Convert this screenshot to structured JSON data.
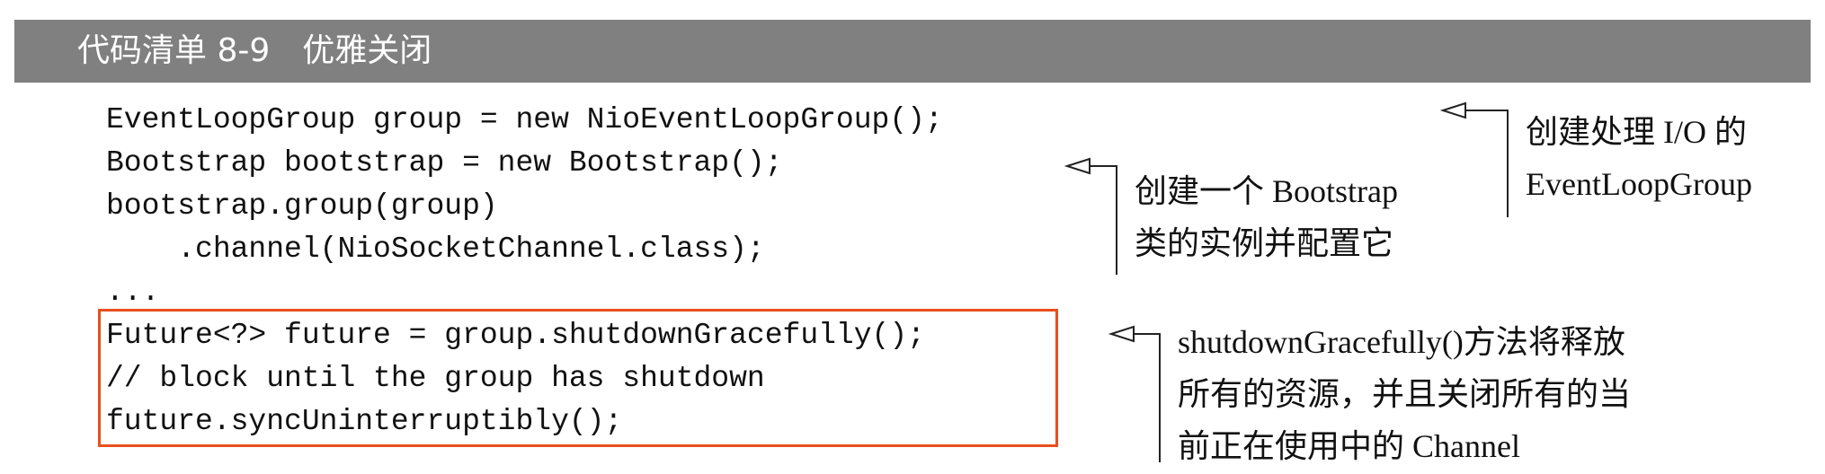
{
  "listing": {
    "title": "代码清单 8-9　优雅关闭"
  },
  "code_lines": [
    "EventLoopGroup group = new NioEventLoopGroup();",
    "Bootstrap bootstrap = new Bootstrap();",
    "bootstrap.group(group)",
    "    .channel(NioSocketChannel.class);",
    "...",
    "Future<?> future = group.shutdownGracefully();",
    "// block until the group has shutdown",
    "future.syncUninterruptibly();"
  ],
  "annotations": {
    "event_loop_group": {
      "lines": [
        "创建处理 I/O 的",
        "EventLoopGroup"
      ]
    },
    "bootstrap": {
      "lines": [
        "创建一个 Bootstrap",
        "类的实例并配置它"
      ]
    },
    "shutdown": {
      "lines": [
        "shutdownGracefully()方法将释放",
        "所有的资源，并且关闭所有的当",
        "前正在使用中的 Channel"
      ]
    }
  },
  "colors": {
    "header_bg": "#808080",
    "header_text": "#ffffff",
    "highlight_border": "#e8501e"
  }
}
